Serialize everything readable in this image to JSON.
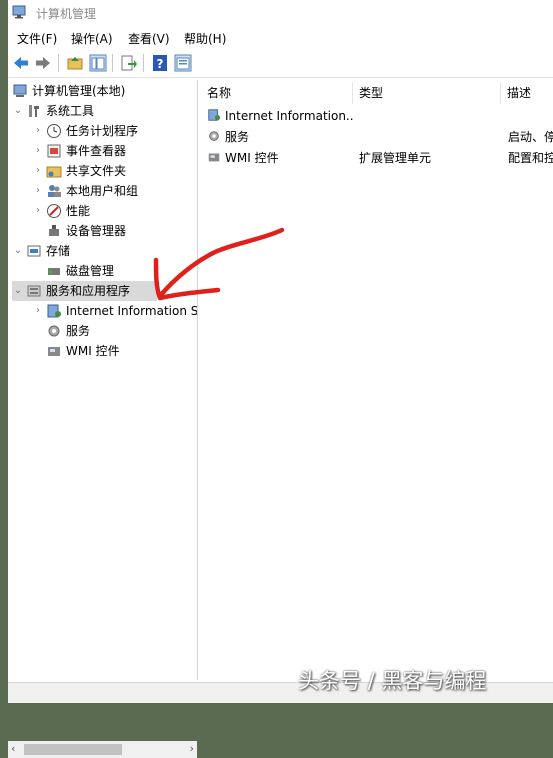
{
  "window": {
    "title": "计算机管理"
  },
  "menu": {
    "items": [
      "文件(F)",
      "操作(A)",
      "查看(V)",
      "帮助(H)"
    ]
  },
  "toolbar": {
    "buttons": [
      "back-icon",
      "forward-icon",
      "up-folder-icon",
      "show-tree-icon",
      "export-icon",
      "help-icon",
      "properties-icon"
    ]
  },
  "tree": {
    "root": "计算机管理(本地)",
    "system_tools": "系统工具",
    "task_scheduler": "任务计划程序",
    "event_viewer": "事件查看器",
    "shared_folders": "共享文件夹",
    "local_users": "本地用户和组",
    "performance": "性能",
    "device_manager": "设备管理器",
    "storage": "存储",
    "disk_mgmt": "磁盘管理",
    "services_apps": "服务和应用程序",
    "iis": "Internet Information S",
    "services": "服务",
    "wmi": "WMI 控件"
  },
  "list": {
    "columns": {
      "name": "名称",
      "type": "类型",
      "desc": "描述"
    },
    "rows": [
      {
        "name": "Internet Information...",
        "type": "",
        "desc": ""
      },
      {
        "name": "服务",
        "type": "",
        "desc": "启动、停"
      },
      {
        "name": "WMI 控件",
        "type": "扩展管理单元",
        "desc": "配置和控"
      }
    ]
  },
  "watermark": "头条号 / 黑客与编程",
  "colors": {
    "accent_blue": "#2f7fd6",
    "annotation_red": "#e0201a",
    "selection": "#d9d9d9"
  }
}
